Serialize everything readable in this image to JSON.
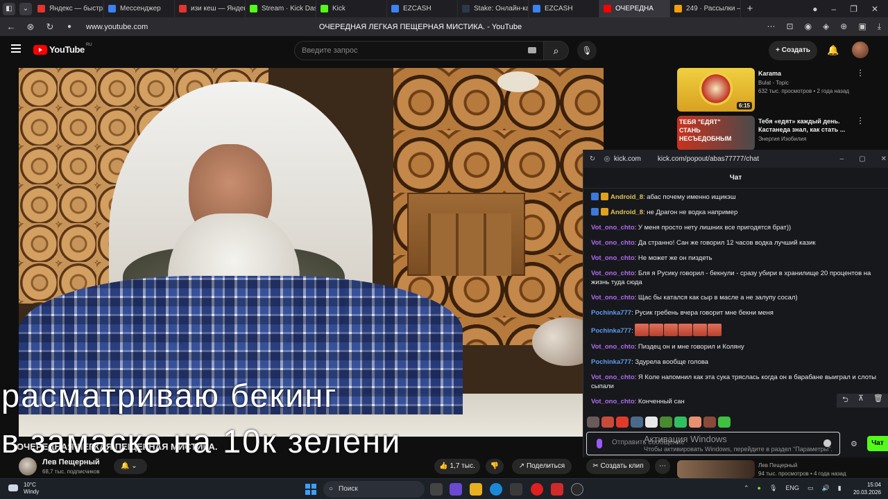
{
  "browser": {
    "tabs": [
      {
        "label": "Яндекс — быстры",
        "icon": "yandex-icon",
        "color": "#e3342f"
      },
      {
        "label": "Мессенджер",
        "icon": "messenger-icon",
        "color": "#3b82f6"
      },
      {
        "label": "изи кеш — Яндек",
        "icon": "yandex-icon",
        "color": "#e3342f"
      },
      {
        "label": "Stream · Kick Dasl",
        "icon": "kick-icon",
        "color": "#53fc18"
      },
      {
        "label": "Kick",
        "icon": "kick-icon",
        "color": "#53fc18"
      },
      {
        "label": "EZCASH",
        "icon": "globe-icon",
        "color": "#3b82f6"
      },
      {
        "label": "Stake: Онлайн-ка",
        "icon": "stake-icon",
        "color": "#2a3a4a"
      },
      {
        "label": "EZCASH",
        "icon": "globe-icon",
        "color": "#3b82f6"
      },
      {
        "label": "ОЧЕРЕДНА",
        "icon": "youtube-icon",
        "color": "#ff0000",
        "active": true
      },
      {
        "label": "249 · Рассылки —",
        "icon": "mail-icon",
        "color": "#f59e0b"
      }
    ],
    "url": "www.youtube.com",
    "page_title": "ОЧЕРЕДНАЯ ЛЕГКАЯ ПЕЩЕРНАЯ МИСТИКА. - YouTube"
  },
  "youtube": {
    "logo": "YouTube",
    "region": "RU",
    "search_placeholder": "Введите запрос",
    "create_label": "Создать",
    "subtitle_line1": "расматриваю бекинг",
    "subtitle_line2": "в замаске  на 10к зелени",
    "video_title": "ОЧЕРЕДНАЯ ЛЕГКАЯ ПЕЩЕРНАЯ МИСТИКА.",
    "channel_name": "Лев Пещерный",
    "channel_subs": "68,7 тыс. подписчиков",
    "like_count": "1,7 тыс.",
    "share_label": "Поделиться",
    "clip_label": "Создать клип",
    "recommendations": [
      {
        "title": "Karama",
        "channel": "Bulat - Topic",
        "meta": "632 тыс. просмотров • 2 года назад",
        "duration": "6:15"
      },
      {
        "title": "Тебя «едят» каждый день. Кастанеда знал, как стать ...",
        "channel": "Энергия Изобилия",
        "meta": "",
        "thumb_text": "ТЕБЯ \"ЕДЯТ\" СТАНЬ НЕСЪЕДОБНЫМ"
      },
      {
        "title": "",
        "channel": "Лев Пещерный",
        "meta": "94 тыс. просмотров • 4 года назад"
      }
    ]
  },
  "kick": {
    "domain": "kick.com",
    "url": "kick.com/popout/abas77777/chat",
    "header": "Чат",
    "messages": [
      {
        "user": "Android_8",
        "text": ": абас почему именно ищикэш",
        "color": "#e0c45a",
        "badges": true
      },
      {
        "user": "Android_8",
        "text": ": не Драгон не водка например",
        "color": "#e0c45a",
        "badges": true
      },
      {
        "user": "Vot_ono_chto",
        "text": ": У меня просто нету лишних все пригодятся брат))",
        "color": "#b06cf0"
      },
      {
        "user": "Vot_ono_chto",
        "text": ": Да странно! Сан же говорил 12 часов водка лучший казик",
        "color": "#b06cf0"
      },
      {
        "user": "Vot_ono_chto",
        "text": ": Не может же он пиздеть",
        "color": "#b06cf0"
      },
      {
        "user": "Vot_ono_chto",
        "text": ": Бля я Русику говорил - бекнули - сразу убири в хранилище 20 процентов на жизнь туда сюда",
        "color": "#b06cf0"
      },
      {
        "user": "Vot_ono_chto",
        "text": ": Щас бы катался как сыр в масле а не залупу сосал)",
        "color": "#b06cf0"
      },
      {
        "user": "Pochinka777",
        "text": ": Русик гребень вчера говорит мне бекни меня",
        "color": "#5b9cf0"
      },
      {
        "user": "Pochinka777",
        "text": ":",
        "color": "#5b9cf0",
        "emotes": 6
      },
      {
        "user": "Vot_ono_chto",
        "text": ": Пиздец он и мне говорил и Коляну",
        "color": "#b06cf0"
      },
      {
        "user": "Pochinka777",
        "text": ": Здурела вообще голова",
        "color": "#5b9cf0"
      },
      {
        "user": "Vot_ono_chto",
        "text": ": Я Коле напомнил как эта сука тряслась когда он в барабане выиграл и слоты сыпали",
        "color": "#b06cf0"
      },
      {
        "user": "Vot_ono_chto",
        "text": ": Конченный сан",
        "color": "#b06cf0"
      }
    ],
    "input_placeholder": "Отправить сообщение",
    "send_label": "Чат"
  },
  "windows": {
    "activation_title": "Активация Windows",
    "activation_text": "Чтобы активировать Windows, перейдите в раздел \"Параметры\".",
    "weather_temp": "10°C",
    "weather_desc": "Windy",
    "search_label": "Поиск",
    "lang": "ENG",
    "time": "15:04",
    "date": "20.03.2026"
  }
}
